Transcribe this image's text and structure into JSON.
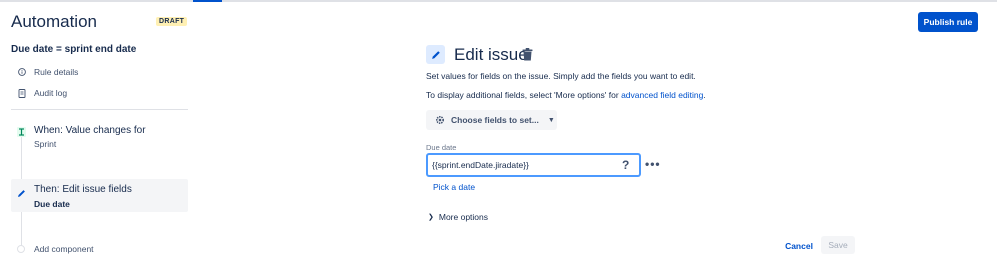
{
  "header": {
    "app_title": "Automation",
    "draft_badge": "DRAFT",
    "publish_label": "Publish rule"
  },
  "sidebar": {
    "rule_name": "Due date = sprint end date",
    "links": [
      {
        "label": "Rule details",
        "icon": "info-icon"
      },
      {
        "label": "Audit log",
        "icon": "document-icon"
      }
    ],
    "trigger": {
      "title": "When: Value changes for",
      "subtitle": "Sprint"
    },
    "action": {
      "title": "Then: Edit issue fields",
      "subtitle": "Due date"
    },
    "add_component_label": "Add component"
  },
  "main": {
    "title": "Edit issue",
    "description": "Set values for fields on the issue. Simply add the fields you want to edit.",
    "hint_prefix": "To display additional fields, select 'More options' for ",
    "hint_link": "advanced field editing",
    "hint_suffix": ".",
    "choose_fields_label": "Choose fields to set...",
    "field": {
      "label": "Due date",
      "value": "{{sprint.endDate.jiradate}}",
      "help": "?",
      "more": "•••"
    },
    "pick_date_label": "Pick a date",
    "more_options_label": "More options",
    "cancel_label": "Cancel",
    "save_label": "Save"
  },
  "colors": {
    "accent": "#0052cc",
    "badge_bg": "#fff0b3",
    "focus_border": "#4c9aff"
  }
}
